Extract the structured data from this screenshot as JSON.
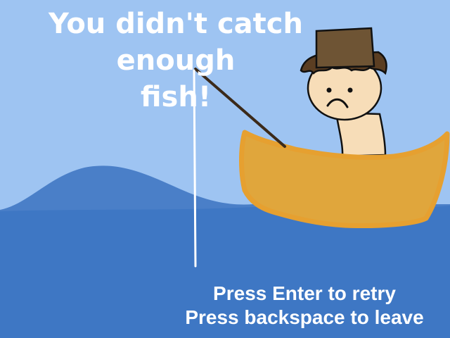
{
  "message": {
    "line1": "You didn't catch enough",
    "line2": "fish!"
  },
  "controls": {
    "retry": "Press Enter to retry",
    "leave": "Press backspace to leave"
  },
  "colors": {
    "sky": "#9ec4f2",
    "water_back": "#4a7fc8",
    "water_front": "#3e77c4",
    "boat": "#e0a63c",
    "boat_outline": "#e6a030",
    "skin": "#f7ddb8",
    "hat": "#6e5434",
    "hair": "#5b3e22",
    "text": "#ffffff"
  }
}
